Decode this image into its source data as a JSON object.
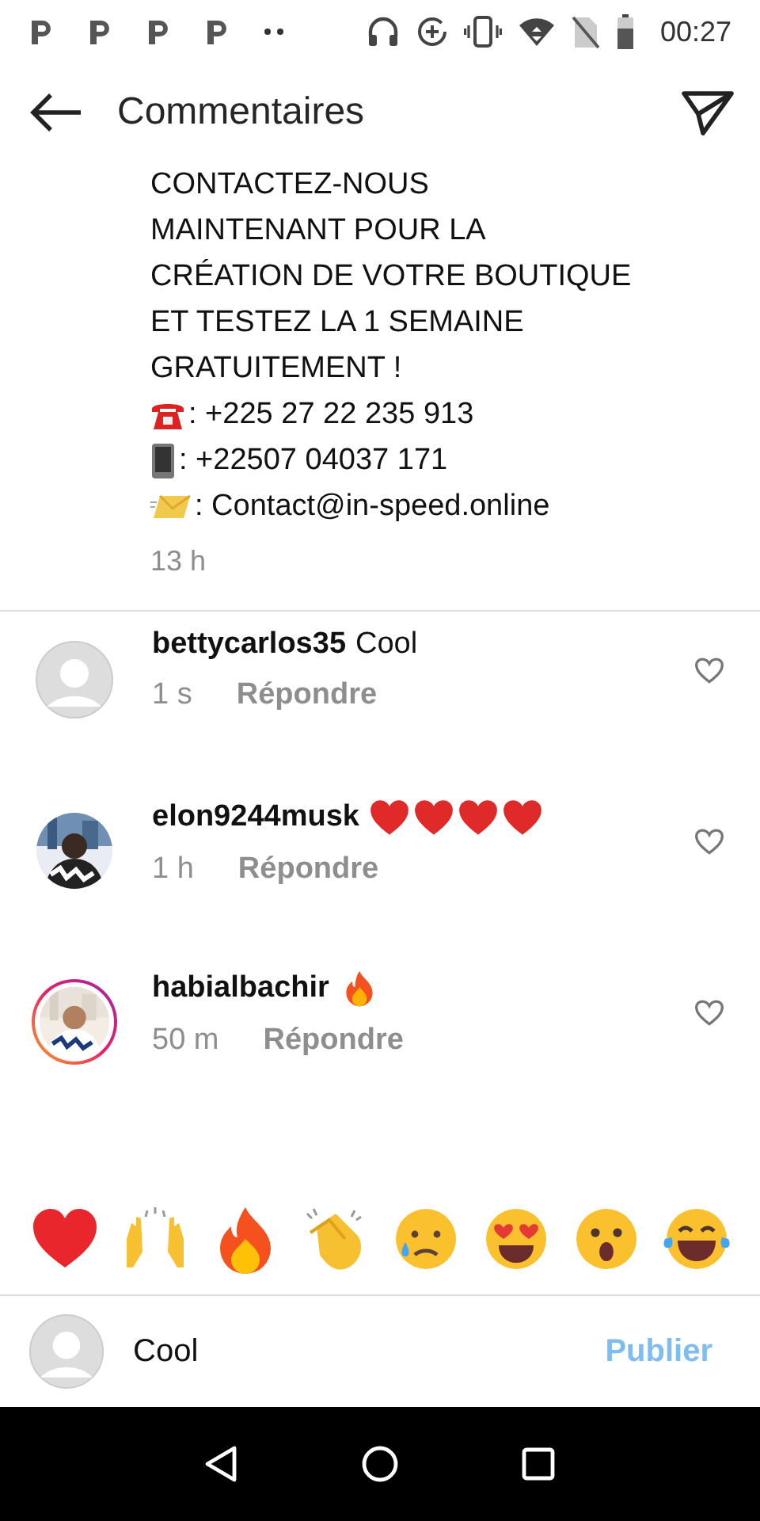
{
  "status_bar": {
    "time": "00:27"
  },
  "header": {
    "title": "Commentaires"
  },
  "caption": {
    "lines": [
      {
        "text": "CONTACTEZ-NOUS"
      },
      {
        "text": "MAINTENANT POUR LA"
      },
      {
        "text": "CRÉATION DE VOTRE BOUTIQUE"
      },
      {
        "text": "ET TESTEZ LA 1 SEMAINE"
      },
      {
        "text": "GRATUITEMENT !"
      },
      {
        "kind": "telephone",
        "text": ": +225 27 22 235 913"
      },
      {
        "kind": "mobile",
        "text": ": +22507 04037 171"
      },
      {
        "kind": "envelope",
        "text": ": Contact@in-speed.online"
      }
    ],
    "time": "13 h"
  },
  "comments": [
    {
      "username": "bettycarlos35",
      "kind": "default",
      "story_ring": false,
      "body": [
        {
          "kind": "text",
          "text": "Cool"
        }
      ],
      "time": "1 s",
      "reply": "Répondre",
      "liked": false
    },
    {
      "username": "elon9244musk",
      "kind": "picture",
      "story_ring": false,
      "body": [
        {
          "kind": "heart"
        },
        {
          "kind": "heart"
        },
        {
          "kind": "heart"
        },
        {
          "kind": "heart"
        }
      ],
      "time": "1 h",
      "reply": "Répondre",
      "liked": false
    },
    {
      "username": "habialbachir",
      "kind": "picture",
      "story_ring": true,
      "body": [
        {
          "kind": "fire"
        }
      ],
      "time": "50 m",
      "reply": "Répondre",
      "liked": false
    }
  ],
  "composer": {
    "value": "Cool",
    "publish": "Publier",
    "disabled": true
  }
}
